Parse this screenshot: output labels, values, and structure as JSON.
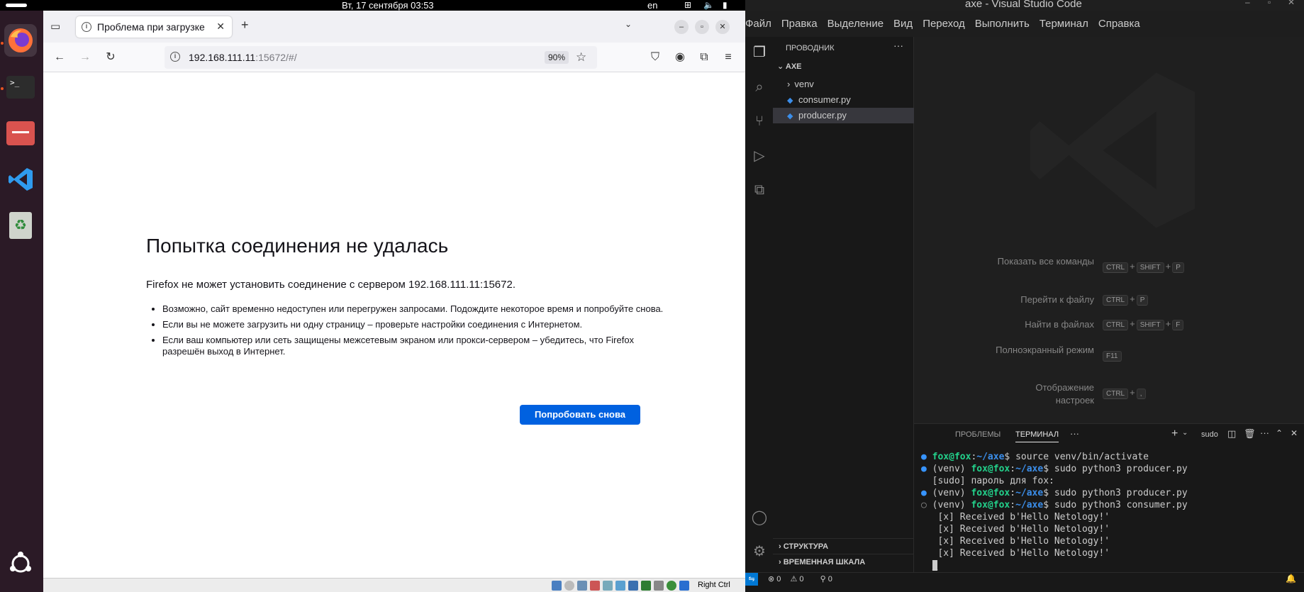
{
  "topbar": {
    "datetime": "Вт, 17 сентября  03:53",
    "lang": "en"
  },
  "dock": {
    "items": [
      {
        "name": "firefox",
        "icon": "firefox-icon"
      },
      {
        "name": "terminal",
        "icon": "terminal-icon"
      },
      {
        "name": "files",
        "icon": "files-icon"
      },
      {
        "name": "vscode",
        "icon": "vscode-icon"
      },
      {
        "name": "trash",
        "icon": "trash-icon"
      },
      {
        "name": "apps",
        "icon": "ubuntu-icon"
      }
    ]
  },
  "firefox": {
    "tab_title": "Проблема при загрузке",
    "url_host": "192.168.111.11",
    "url_rest": ":15672/#/",
    "zoom": "90%",
    "error": {
      "title": "Попытка соединения не удалась",
      "description": "Firefox не может установить соединение с сервером 192.168.111.11:15672.",
      "bullets": [
        "Возможно, сайт временно недоступен или перегружен запросами. Подождите некоторое время и попробуйте снова.",
        "Если вы не можете загрузить ни одну страницу – проверьте настройки соединения с Интернетом.",
        "Если ваш компьютер или сеть защищены межсетевым экраном или прокси-сервером – убедитесь, что Firefox разрешён выход в Интернет."
      ],
      "retry_label": "Попробовать снова"
    },
    "vbox_status_label": "Right Ctrl"
  },
  "vscode": {
    "window_title": "axe - Visual Studio Code",
    "menu": [
      "Файл",
      "Правка",
      "Выделение",
      "Вид",
      "Переход",
      "Выполнить",
      "Терминал",
      "Справка"
    ],
    "explorer_header": "ПРОВОДНИК",
    "folder": "AXE",
    "tree": [
      {
        "label": "venv",
        "type": "folder"
      },
      {
        "label": "consumer.py",
        "type": "py"
      },
      {
        "label": "producer.py",
        "type": "py",
        "selected": true
      }
    ],
    "side_sections": [
      "СТРУКТУРА",
      "ВРЕМЕННАЯ ШКАЛА"
    ],
    "shortcuts": [
      {
        "label": "Показать все команды",
        "keys": [
          "CTRL",
          "SHIFT",
          "P"
        ]
      },
      {
        "label": "Перейти к файлу",
        "keys": [
          "CTRL",
          "P"
        ]
      },
      {
        "label": "Найти в файлах",
        "keys": [
          "CTRL",
          "SHIFT",
          "F"
        ]
      },
      {
        "label": "Полноэкранный режим",
        "keys": [
          "F11"
        ]
      },
      {
        "label": "Отображение настроек",
        "keys": [
          "CTRL",
          ","
        ]
      }
    ],
    "panel_tabs": [
      "ПРОБЛЕМЫ",
      "ТЕРМИНАЛ"
    ],
    "terminal_shell": "sudo",
    "terminal": {
      "user_host": "fox@fox",
      "path": "~/axe",
      "venv": "(venv) ",
      "cmd1": "source venv/bin/activate",
      "cmd2": "sudo python3 producer.py",
      "sudo_prompt": "[sudo] пароль для fox:",
      "cmd3": "sudo python3 producer.py",
      "cmd4": "sudo python3 consumer.py",
      "received": " [x] Received b'Hello Netology!'"
    },
    "status": {
      "errors": "0",
      "warnings": "0",
      "ports": "0"
    },
    "colors": {
      "accent": "#0078d4",
      "selection": "#37373d"
    }
  }
}
